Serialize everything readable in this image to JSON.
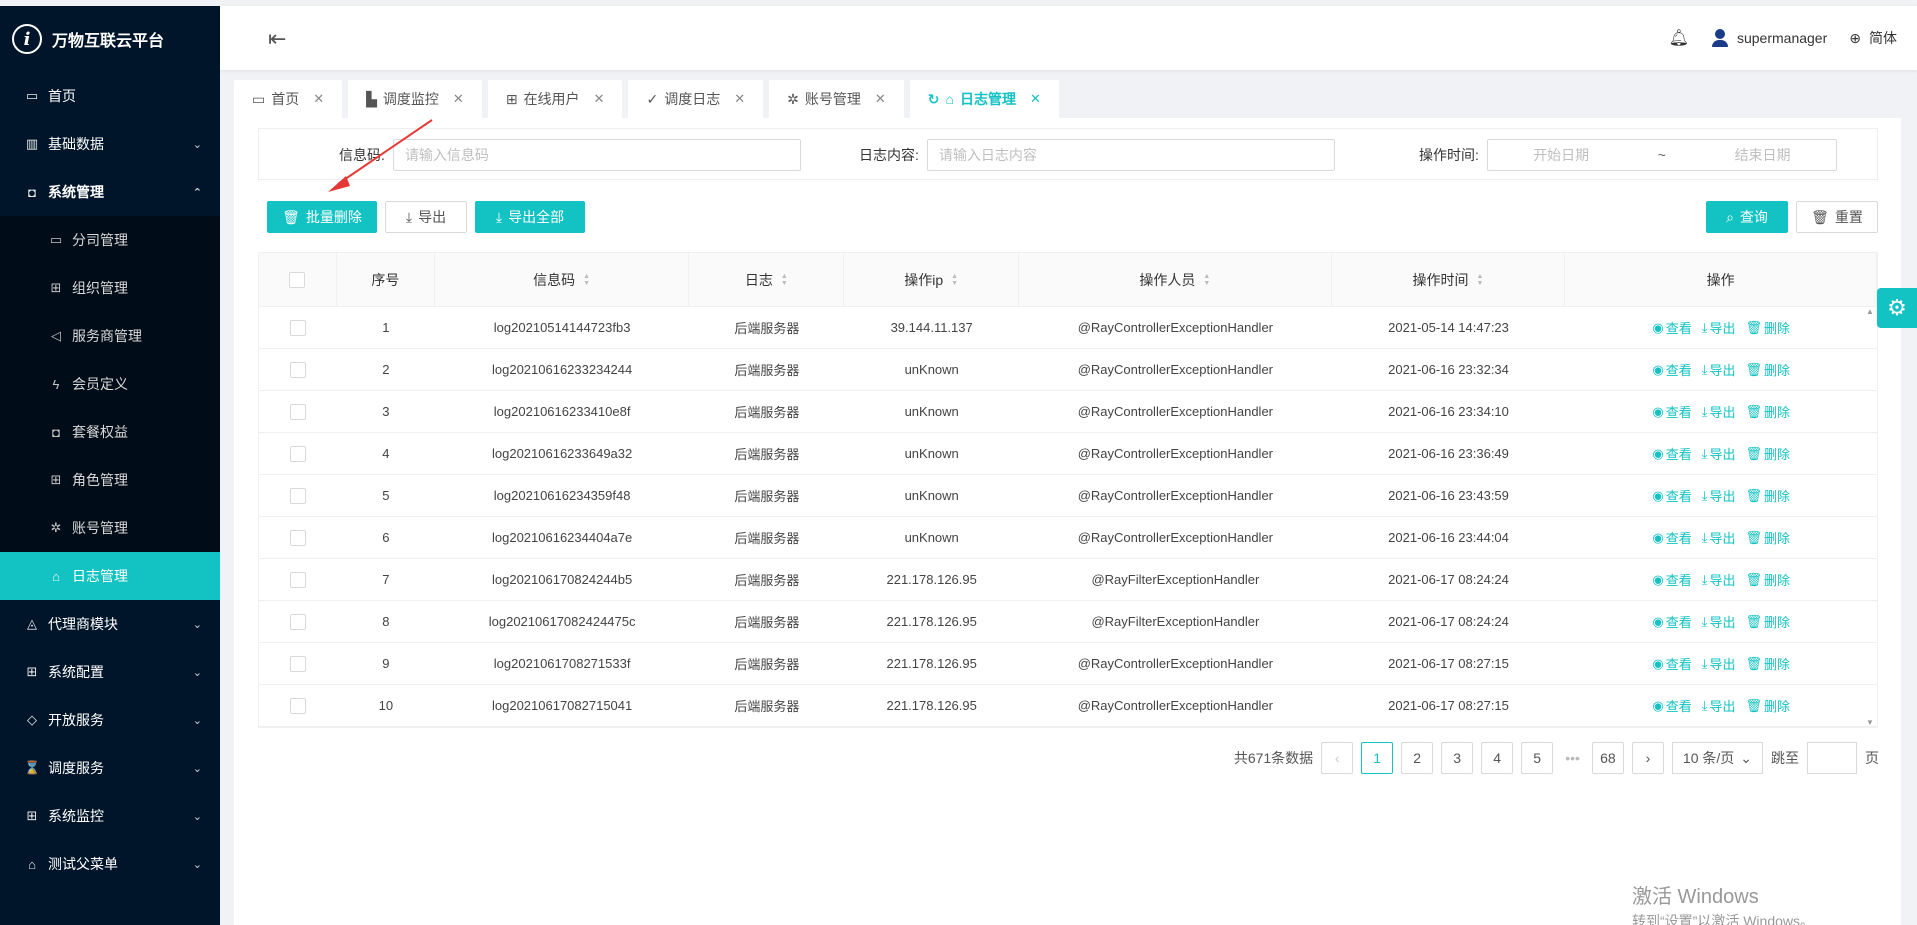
{
  "app": {
    "title": "万物互联云平台"
  },
  "sidebar": {
    "items": [
      {
        "label": "首页",
        "icon": "calendar-icon"
      },
      {
        "label": "基础数据",
        "icon": "barcode-icon"
      },
      {
        "label": "系统管理",
        "icon": "camera-icon"
      },
      {
        "label": "代理商模块",
        "icon": "bell-icon"
      },
      {
        "label": "系统配置",
        "icon": "grid-icon"
      },
      {
        "label": "开放服务",
        "icon": "tag-icon"
      },
      {
        "label": "调度服务",
        "icon": "hourglass-icon"
      },
      {
        "label": "系统监控",
        "icon": "grid-icon"
      },
      {
        "label": "测试父菜单",
        "icon": "bank-icon"
      }
    ],
    "submenu": [
      {
        "label": "分司管理",
        "icon": "calendar-icon"
      },
      {
        "label": "组织管理",
        "icon": "grid-icon"
      },
      {
        "label": "服务商管理",
        "icon": "sound-icon"
      },
      {
        "label": "会员定义",
        "icon": "lightning-icon"
      },
      {
        "label": "套餐权益",
        "icon": "camera-icon"
      },
      {
        "label": "角色管理",
        "icon": "grid-icon"
      },
      {
        "label": "账号管理",
        "icon": "bug-icon"
      },
      {
        "label": "日志管理",
        "icon": "home-icon"
      }
    ]
  },
  "header": {
    "username": "supermanager",
    "language": "简体"
  },
  "tabs": [
    {
      "label": "首页",
      "icon": "calendar-icon"
    },
    {
      "label": "调度监控",
      "icon": "chart-icon"
    },
    {
      "label": "在线用户",
      "icon": "table-icon"
    },
    {
      "label": "调度日志",
      "icon": "check-icon"
    },
    {
      "label": "账号管理",
      "icon": "bug-icon"
    },
    {
      "label": "日志管理",
      "icon": "home-icon"
    }
  ],
  "search": {
    "code_label": "信息码:",
    "code_placeholder": "请输入信息码",
    "content_label": "日志内容:",
    "content_placeholder": "请输入日志内容",
    "time_label": "操作时间:",
    "start_placeholder": "开始日期",
    "range_sep": "~",
    "end_placeholder": "结束日期"
  },
  "toolbar": {
    "batch_delete": "批量删除",
    "export": "导出",
    "export_all": "导出全部",
    "query": "查询",
    "reset": "重置"
  },
  "table": {
    "headers": [
      "序号",
      "信息码",
      "日志",
      "操作ip",
      "操作人员",
      "操作时间",
      "操作"
    ],
    "actions": {
      "view": "查看",
      "export": "导出",
      "delete": "删除"
    },
    "rows": [
      {
        "no": "1",
        "code": "log20210514144723fb3",
        "log": "后端服务器",
        "ip": "39.144.11.137",
        "operator": "@RayControllerExceptionHandler",
        "time": "2021-05-14 14:47:23"
      },
      {
        "no": "2",
        "code": "log20210616233234244",
        "log": "后端服务器",
        "ip": "unKnown",
        "operator": "@RayControllerExceptionHandler",
        "time": "2021-06-16 23:32:34"
      },
      {
        "no": "3",
        "code": "log20210616233410e8f",
        "log": "后端服务器",
        "ip": "unKnown",
        "operator": "@RayControllerExceptionHandler",
        "time": "2021-06-16 23:34:10"
      },
      {
        "no": "4",
        "code": "log20210616233649a32",
        "log": "后端服务器",
        "ip": "unKnown",
        "operator": "@RayControllerExceptionHandler",
        "time": "2021-06-16 23:36:49"
      },
      {
        "no": "5",
        "code": "log20210616234359f48",
        "log": "后端服务器",
        "ip": "unKnown",
        "operator": "@RayControllerExceptionHandler",
        "time": "2021-06-16 23:43:59"
      },
      {
        "no": "6",
        "code": "log20210616234404a7e",
        "log": "后端服务器",
        "ip": "unKnown",
        "operator": "@RayControllerExceptionHandler",
        "time": "2021-06-16 23:44:04"
      },
      {
        "no": "7",
        "code": "log202106170824244b5",
        "log": "后端服务器",
        "ip": "221.178.126.95",
        "operator": "@RayFilterExceptionHandler",
        "time": "2021-06-17 08:24:24"
      },
      {
        "no": "8",
        "code": "log20210617082424475c",
        "log": "后端服务器",
        "ip": "221.178.126.95",
        "operator": "@RayFilterExceptionHandler",
        "time": "2021-06-17 08:24:24"
      },
      {
        "no": "9",
        "code": "log2021061708271533f",
        "log": "后端服务器",
        "ip": "221.178.126.95",
        "operator": "@RayControllerExceptionHandler",
        "time": "2021-06-17 08:27:15"
      },
      {
        "no": "10",
        "code": "log2021061708271504​1",
        "log": "后端服务器",
        "ip": "221.178.126.95",
        "operator": "@RayControllerExceptionHandler",
        "time": "2021-06-17 08:27:15"
      }
    ]
  },
  "pagination": {
    "total": "共671条数据",
    "pages": [
      "1",
      "2",
      "3",
      "4",
      "5"
    ],
    "ellipsis": "•••",
    "last": "68",
    "page_size": "10 条/页",
    "jump_label": "跳至",
    "page_unit": "页"
  },
  "watermark": {
    "line1": "激活 Windows",
    "line2": "转到“设置”以激活 Windows。"
  },
  "colors": {
    "accent": "#13c2c2",
    "sidebar": "#001529",
    "arrow": "#e53935"
  }
}
